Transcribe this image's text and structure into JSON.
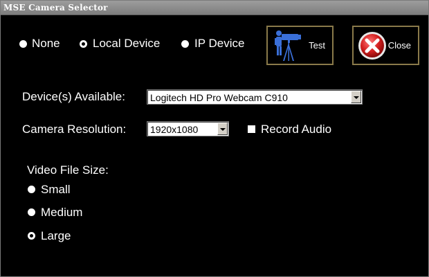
{
  "window": {
    "title": "MSE Camera Selector"
  },
  "source_options": [
    {
      "label": "None",
      "checked": false
    },
    {
      "label": "Local Device",
      "checked": true
    },
    {
      "label": "IP Device",
      "checked": false
    }
  ],
  "buttons": {
    "test": "Test",
    "close": "Close"
  },
  "icons": {
    "test": "camera-operator-icon",
    "close": "red-x-close-icon"
  },
  "devices": {
    "label": "Device(s) Available:",
    "selected": "Logitech HD Pro Webcam C910"
  },
  "resolution": {
    "label": "Camera Resolution:",
    "selected": "1920x1080"
  },
  "record_audio": {
    "label": "Record Audio",
    "checked": false
  },
  "file_size": {
    "label": "Video File Size:",
    "options": [
      {
        "label": "Small",
        "checked": false
      },
      {
        "label": "Medium",
        "checked": false
      },
      {
        "label": "Large",
        "checked": true
      }
    ]
  },
  "colors": {
    "background": "#000000",
    "text": "#ffffff",
    "button_border": "#8a7a4a",
    "close_red": "#d42020"
  }
}
